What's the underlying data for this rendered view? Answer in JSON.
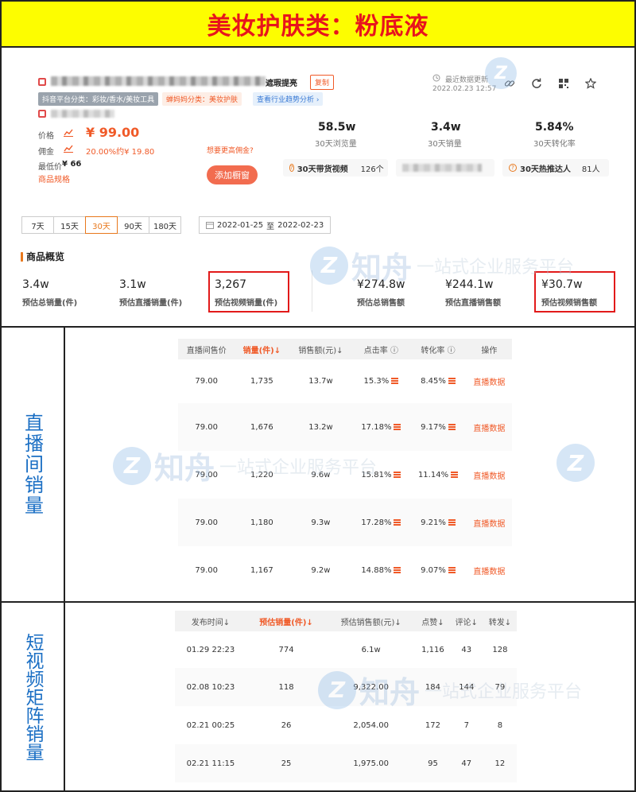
{
  "banner": {
    "title": "美妆护肤类：粉底液"
  },
  "product": {
    "title_suffix": "遮瑕提亮",
    "copy_label": "复制",
    "tag_platform": "抖音平台分类：彩妆/香水/美妆工具",
    "tag_mama": "蝉妈妈分类：美妆护肤",
    "tag_trend": "查看行业趋势分析 ›",
    "price_label": "价格",
    "price_value": "¥ 99.00",
    "commission_label": "佣金",
    "commission_value": "20.00%约¥ 19.80",
    "higher_commission": "想要更高佣金?",
    "lowest_label": "最低价",
    "lowest_value": "¥ 66",
    "spec_link": "商品规格",
    "add_window": "添加橱窗",
    "update_label": "最近数据更新",
    "update_time": "2022.02.23 12:57",
    "stats": [
      {
        "value": "58.5w",
        "label": "30天浏览量"
      },
      {
        "value": "3.4w",
        "label": "30天销量"
      },
      {
        "value": "5.84%",
        "label": "30天转化率"
      }
    ],
    "pill_video_label": "30天带货视频",
    "pill_video_value": "126个",
    "pill_talent_label": "30天热推达人",
    "pill_talent_value": "81人"
  },
  "filters": {
    "tabs": [
      "7天",
      "15天",
      "30天",
      "90天",
      "180天"
    ],
    "active_tab": "30天",
    "date_start": "2022-01-25",
    "date_sep": "至",
    "date_end": "2022-02-23"
  },
  "overview": {
    "title": "商品概览",
    "items": [
      {
        "value": "3.4w",
        "label": "预估总销量(件)"
      },
      {
        "value": "3.1w",
        "label": "预估直播销量(件)"
      },
      {
        "value": "3,267",
        "label": "预估视频销量(件)"
      },
      {
        "value": "¥274.8w",
        "label": "预估总销售额"
      },
      {
        "value": "¥244.1w",
        "label": "预估直播销售额"
      },
      {
        "value": "¥30.7w",
        "label": "预估视频销售额"
      }
    ]
  },
  "watermark": {
    "brand": "知舟",
    "slogan": "一站式企业服务平台"
  },
  "live": {
    "side_label": "直播间销量",
    "headers": [
      "直播间售价",
      "销量(件)↓",
      "销售额(元)↓",
      "点击率 ⓘ",
      "转化率 ⓘ",
      "操作"
    ],
    "rows": [
      [
        "79.00",
        "1,735",
        "13.7w",
        "15.3%",
        "8.45%",
        "直播数据"
      ],
      [
        "79.00",
        "1,676",
        "13.2w",
        "17.18%",
        "9.17%",
        "直播数据"
      ],
      [
        "79.00",
        "1,220",
        "9.6w",
        "15.81%",
        "11.14%",
        "直播数据"
      ],
      [
        "79.00",
        "1,180",
        "9.3w",
        "17.28%",
        "9.21%",
        "直播数据"
      ],
      [
        "79.00",
        "1,167",
        "9.2w",
        "14.88%",
        "9.07%",
        "直播数据"
      ]
    ]
  },
  "video": {
    "side_label": "短视频矩阵销量",
    "headers": [
      "发布时间↓",
      "预估销量(件)↓",
      "预估销售额(元)↓",
      "点赞↓",
      "评论↓",
      "转发↓"
    ],
    "rows": [
      [
        "01.29 22:23",
        "774",
        "6.1w",
        "1,116",
        "43",
        "128"
      ],
      [
        "02.08 10:23",
        "118",
        "9,322.00",
        "184",
        "144",
        "79"
      ],
      [
        "02.21 00:25",
        "26",
        "2,054.00",
        "172",
        "7",
        "8"
      ],
      [
        "02.21 11:15",
        "25",
        "1,975.00",
        "95",
        "47",
        "12"
      ]
    ]
  }
}
